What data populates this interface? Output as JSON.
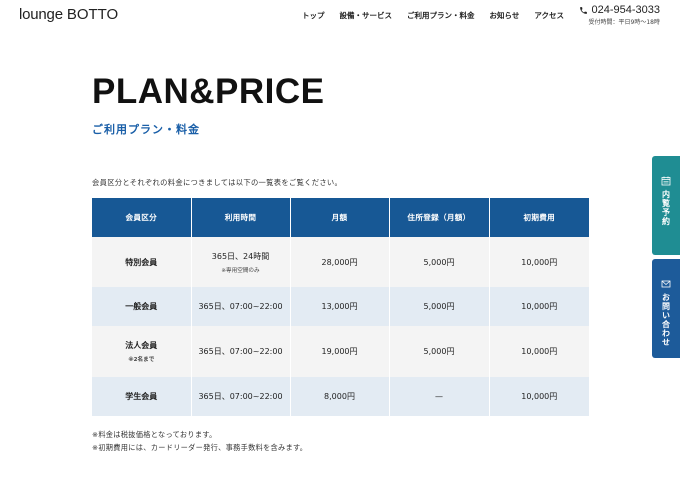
{
  "header": {
    "logo_light": "lounge ",
    "logo_bold": "BOTTO",
    "nav": [
      "トップ",
      "設備・サービス",
      "ご利用プラン・料金",
      "お知らせ",
      "アクセス"
    ],
    "phone": "024-954-3033",
    "hours": "受付時間：平日9時〜18時"
  },
  "main": {
    "title": "PLAN&PRICE",
    "subtitle": "ご利用プラン・料金",
    "intro": "会員区分とそれぞれの料金につきましては以下の一覧表をご覧ください。",
    "table": {
      "headers": [
        "会員区分",
        "利用時間",
        "月額",
        "住所登録（月額）",
        "初期費用"
      ],
      "rows": [
        {
          "type": "特別会員",
          "type_note": "",
          "hours": "365日、24時間",
          "hours_note": "※専用空間のみ",
          "monthly": "28,000円",
          "address": "5,000円",
          "initial": "10,000円"
        },
        {
          "type": "一般会員",
          "type_note": "",
          "hours": "365日、07:00~22:00",
          "hours_note": "",
          "monthly": "13,000円",
          "address": "5,000円",
          "initial": "10,000円"
        },
        {
          "type": "法人会員",
          "type_note": "※2名まで",
          "hours": "365日、07:00~22:00",
          "hours_note": "",
          "monthly": "19,000円",
          "address": "5,000円",
          "initial": "10,000円"
        },
        {
          "type": "学生会員",
          "type_note": "",
          "hours": "365日、07:00~22:00",
          "hours_note": "",
          "monthly": "8,000円",
          "address": "—",
          "initial": "10,000円"
        }
      ]
    },
    "notes": [
      "※料金は税抜価格となっております。",
      "※初期費用には、カードリーダー発行、事務手数料を含みます。"
    ]
  },
  "side": {
    "reserve": "内覧予約",
    "contact": "お問い合わせ"
  },
  "colors": {
    "header_blue": "#175895",
    "subtitle_blue": "#1a5fa8",
    "row_gray": "#f4f4f4",
    "row_blue": "#e3ebf3",
    "reserve_teal": "#1f8d93",
    "contact_blue": "#1d5b9a"
  },
  "icons": {
    "phone": "phone-icon",
    "reserve": "calendar-icon",
    "contact": "mail-icon"
  }
}
